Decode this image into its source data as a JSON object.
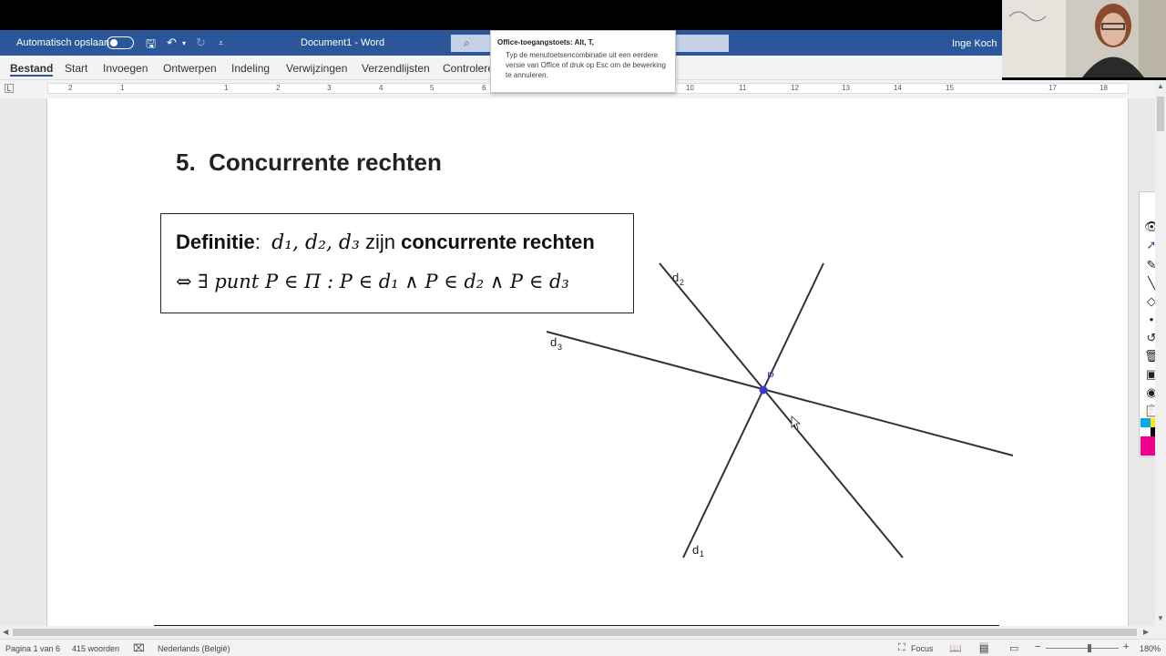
{
  "titlebar": {
    "autosave_label": "Automatisch opslaan",
    "doc_title": "Document1 - Word",
    "user": "Inge Koch"
  },
  "ribbon": {
    "tabs": [
      "Bestand",
      "Start",
      "Invoegen",
      "Ontwerpen",
      "Indeling",
      "Verwijzingen",
      "Verzendlijsten",
      "Controleren"
    ]
  },
  "tooltip": {
    "title": "Office-toegangstoets: Alt, T,",
    "body": "Typ de menutoetsencombinatie uit een eerdere versie van Office of druk op Esc om de bewerking te annuleren."
  },
  "ruler": {
    "labels": [
      "2",
      "1",
      "1",
      "2",
      "3",
      "4",
      "5",
      "6",
      "10",
      "11",
      "12",
      "13",
      "14",
      "15",
      "17",
      "18"
    ]
  },
  "document": {
    "heading_number": "5.",
    "heading_text": "Concurrente rechten",
    "definition": {
      "word": "Definitie",
      "colon": ":",
      "vars": "d₁, d₂, d₃",
      "zijn": "zijn",
      "term": "concurrente rechten",
      "line2": "⇔ ∃ punt P ∈ Π :  P ∈ d₁ ∧ P ∈ d₂ ∧ P ∈ d₃"
    },
    "diagram_labels": {
      "d1": "d",
      "d1_sub": "1",
      "d2": "d",
      "d2_sub": "2",
      "d3": "d",
      "d3_sub": "3",
      "point": "P"
    }
  },
  "statusbar": {
    "page": "Pagina 1 van 6",
    "words": "415 woorden",
    "language": "Nederlands (België)",
    "focus": "Focus",
    "zoom": "180%"
  },
  "colors": {
    "word_blue": "#2b579a",
    "point_color": "#3a3acb",
    "line_color": "#333333"
  }
}
